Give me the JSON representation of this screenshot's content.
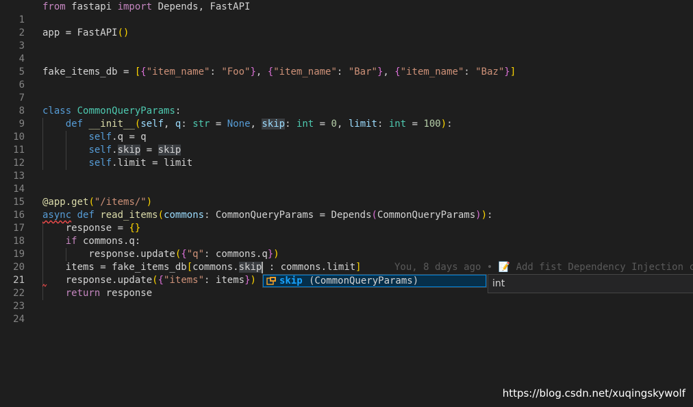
{
  "editor": {
    "line_numbers": [
      "1",
      "2",
      "3",
      "4",
      "5",
      "6",
      "7",
      "8",
      "9",
      "10",
      "11",
      "12",
      "13",
      "14",
      "15",
      "16",
      "17",
      "18",
      "19",
      "20",
      "21",
      "22",
      "23",
      "24"
    ],
    "current_line": "21",
    "blame": "You, 8 days ago • 📝 Add fist Dependency Injection c"
  },
  "suggest": {
    "icon": "field-icon",
    "label": "skip",
    "detail": "(CommonQueryParams)"
  },
  "details": {
    "type": "int"
  },
  "watermark": "https://blog.csdn.net/xuqingskywolf",
  "colors": {
    "background": "#1e1e1e",
    "keyword": "#569cd6",
    "control": "#c586c0",
    "string": "#ce9178",
    "number": "#b5cea8",
    "class": "#4ec9b0",
    "function": "#dcdcaa",
    "variable": "#9cdcfe",
    "suggest_highlight": "#18a3ff"
  }
}
